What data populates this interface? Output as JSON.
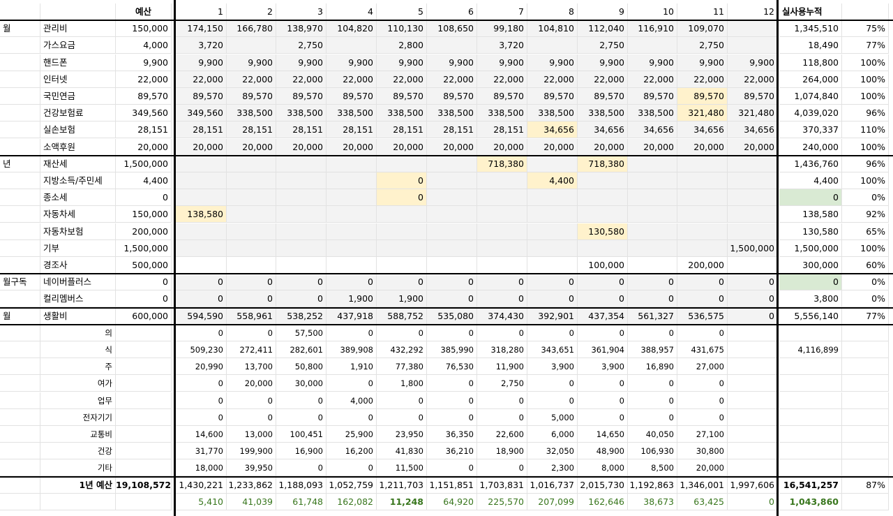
{
  "header": {
    "budget": "예산",
    "months": [
      "1",
      "2",
      "3",
      "4",
      "5",
      "6",
      "7",
      "8",
      "9",
      "10",
      "11",
      "12"
    ],
    "cumulative": "실사용누적"
  },
  "rows": [
    {
      "g": "월",
      "n": "관리비",
      "b": "150,000",
      "m": [
        "174,150",
        "166,780",
        "138,970",
        "104,820",
        "110,130",
        "108,650",
        "99,180",
        "104,810",
        "112,040",
        "116,910",
        "109,070",
        ""
      ],
      "c": "1,345,510",
      "p": "75%",
      "bg": "grey",
      "hi": {}
    },
    {
      "g": "",
      "n": "가스요금",
      "b": "4,000",
      "m": [
        "3,720",
        "",
        "2,750",
        "",
        "2,800",
        "",
        "3,720",
        "",
        "2,750",
        "",
        "2,750",
        ""
      ],
      "c": "18,490",
      "p": "77%",
      "bg": "grey",
      "hi": {}
    },
    {
      "g": "",
      "n": "핸드폰",
      "b": "9,900",
      "m": [
        "9,900",
        "9,900",
        "9,900",
        "9,900",
        "9,900",
        "9,900",
        "9,900",
        "9,900",
        "9,900",
        "9,900",
        "9,900",
        "9,900"
      ],
      "c": "118,800",
      "p": "100%",
      "bg": "grey",
      "hi": {}
    },
    {
      "g": "",
      "n": "인터넷",
      "b": "22,000",
      "m": [
        "22,000",
        "22,000",
        "22,000",
        "22,000",
        "22,000",
        "22,000",
        "22,000",
        "22,000",
        "22,000",
        "22,000",
        "22,000",
        "22,000"
      ],
      "c": "264,000",
      "p": "100%",
      "bg": "grey",
      "hi": {}
    },
    {
      "g": "",
      "n": "국민연금",
      "b": "89,570",
      "m": [
        "89,570",
        "89,570",
        "89,570",
        "89,570",
        "89,570",
        "89,570",
        "89,570",
        "89,570",
        "89,570",
        "89,570",
        "89,570",
        "89,570"
      ],
      "c": "1,074,840",
      "p": "100%",
      "bg": "grey",
      "hi": {
        "11": "yel"
      }
    },
    {
      "g": "",
      "n": "건강보험료",
      "b": "349,560",
      "m": [
        "349,560",
        "338,500",
        "338,500",
        "338,500",
        "338,500",
        "338,500",
        "338,500",
        "338,500",
        "338,500",
        "338,500",
        "321,480",
        "321,480"
      ],
      "c": "4,039,020",
      "p": "96%",
      "bg": "grey",
      "hi": {
        "11": "yel"
      }
    },
    {
      "g": "",
      "n": "실손보험",
      "b": "28,151",
      "m": [
        "28,151",
        "28,151",
        "28,151",
        "28,151",
        "28,151",
        "28,151",
        "28,151",
        "34,656",
        "34,656",
        "34,656",
        "34,656",
        "34,656"
      ],
      "c": "370,337",
      "p": "110%",
      "bg": "grey",
      "hi": {
        "8": "yel"
      }
    },
    {
      "g": "",
      "n": "소액후원",
      "b": "20,000",
      "m": [
        "20,000",
        "20,000",
        "20,000",
        "20,000",
        "20,000",
        "20,000",
        "20,000",
        "20,000",
        "20,000",
        "20,000",
        "20,000",
        "20,000"
      ],
      "c": "240,000",
      "p": "100%",
      "bg": "grey",
      "hi": {}
    },
    {
      "g": "년",
      "n": "재산세",
      "b": "1,500,000",
      "m": [
        "",
        "",
        "",
        "",
        "",
        "",
        "718,380",
        "",
        "718,380",
        "",
        "",
        ""
      ],
      "c": "1,436,760",
      "p": "96%",
      "bg": "grey",
      "hi": {
        "7": "yel",
        "9": "yel"
      }
    },
    {
      "g": "",
      "n": "지방소득/주민세",
      "b": "4,400",
      "m": [
        "",
        "",
        "",
        "",
        "0",
        "",
        "",
        "4,400",
        "",
        "",
        "",
        ""
      ],
      "c": "4,400",
      "p": "100%",
      "bg": "grey",
      "hi": {
        "5": "yel",
        "8": "yel"
      }
    },
    {
      "g": "",
      "n": "종소세",
      "b": "0",
      "m": [
        "",
        "",
        "",
        "",
        "0",
        "",
        "",
        "",
        "",
        "",
        "",
        ""
      ],
      "c": "0",
      "p": "0%",
      "bg": "grey",
      "hi": {
        "5": "yel",
        "c": "grn"
      }
    },
    {
      "g": "",
      "n": "자동차세",
      "b": "150,000",
      "m": [
        "138,580",
        "",
        "",
        "",
        "",
        "",
        "",
        "",
        "",
        "",
        "",
        ""
      ],
      "c": "138,580",
      "p": "92%",
      "bg": "grey",
      "hi": {
        "1": "yel"
      }
    },
    {
      "g": "",
      "n": "자동차보험",
      "b": "200,000",
      "m": [
        "",
        "",
        "",
        "",
        "",
        "",
        "",
        "",
        "130,580",
        "",
        "",
        ""
      ],
      "c": "130,580",
      "p": "65%",
      "bg": "grey",
      "hi": {
        "9": "yel"
      }
    },
    {
      "g": "",
      "n": "기부",
      "b": "1,500,000",
      "m": [
        "",
        "",
        "",
        "",
        "",
        "",
        "",
        "",
        "",
        "",
        "",
        "1,500,000"
      ],
      "c": "1,500,000",
      "p": "100%",
      "bg": "grey",
      "hi": {}
    },
    {
      "g": "",
      "n": "경조사",
      "b": "500,000",
      "m": [
        "",
        "",
        "",
        "",
        "",
        "",
        "",
        "",
        "100,000",
        "",
        "200,000",
        ""
      ],
      "c": "300,000",
      "p": "60%",
      "bg": "white",
      "hi": {}
    },
    {
      "g": "월구독",
      "n": "네이버플러스",
      "b": "0",
      "m": [
        "0",
        "0",
        "0",
        "0",
        "0",
        "0",
        "0",
        "0",
        "0",
        "0",
        "0",
        "0"
      ],
      "c": "0",
      "p": "0%",
      "bg": "grey",
      "hi": {
        "c": "grn"
      }
    },
    {
      "g": "",
      "n": "컬리멤버스",
      "b": "0",
      "m": [
        "0",
        "0",
        "0",
        "1,900",
        "1,900",
        "0",
        "0",
        "0",
        "0",
        "0",
        "0",
        "0"
      ],
      "c": "3,800",
      "p": "0%",
      "bg": "grey",
      "hi": {}
    },
    {
      "g": "월",
      "n": "생활비",
      "b": "600,000",
      "m": [
        "594,590",
        "558,961",
        "538,252",
        "437,918",
        "588,752",
        "535,080",
        "374,430",
        "392,901",
        "437,354",
        "561,327",
        "536,575",
        "0"
      ],
      "c": "5,556,140",
      "p": "77%",
      "bg": "grey",
      "hi": {}
    }
  ],
  "subrows": [
    {
      "n": "의",
      "m": [
        "0",
        "0",
        "57,500",
        "0",
        "0",
        "0",
        "0",
        "0",
        "0",
        "0",
        "0"
      ],
      "c": ""
    },
    {
      "n": "식",
      "m": [
        "509,230",
        "272,411",
        "282,601",
        "389,908",
        "432,292",
        "385,990",
        "318,280",
        "343,651",
        "361,904",
        "388,957",
        "431,675"
      ],
      "c": "4,116,899"
    },
    {
      "n": "주",
      "m": [
        "20,990",
        "13,700",
        "50,800",
        "1,910",
        "77,380",
        "76,530",
        "11,900",
        "3,900",
        "3,900",
        "16,890",
        "27,000"
      ],
      "c": ""
    },
    {
      "n": "여가",
      "m": [
        "0",
        "20,000",
        "30,000",
        "0",
        "1,800",
        "0",
        "2,750",
        "0",
        "0",
        "0",
        "0"
      ],
      "c": ""
    },
    {
      "n": "업무",
      "m": [
        "0",
        "0",
        "0",
        "4,000",
        "0",
        "0",
        "0",
        "0",
        "0",
        "0",
        "0"
      ],
      "c": ""
    },
    {
      "n": "전자기기",
      "m": [
        "0",
        "0",
        "0",
        "0",
        "0",
        "0",
        "0",
        "5,000",
        "0",
        "0",
        "0"
      ],
      "c": ""
    },
    {
      "n": "교통비",
      "m": [
        "14,600",
        "13,000",
        "100,451",
        "25,900",
        "23,950",
        "36,350",
        "22,600",
        "6,000",
        "14,650",
        "40,050",
        "27,100"
      ],
      "c": ""
    },
    {
      "n": "건강",
      "m": [
        "31,770",
        "199,900",
        "16,900",
        "16,200",
        "41,830",
        "36,210",
        "18,900",
        "32,050",
        "48,900",
        "106,930",
        "30,800"
      ],
      "c": ""
    },
    {
      "n": "기타",
      "m": [
        "18,000",
        "39,950",
        "0",
        "0",
        "11,500",
        "0",
        "0",
        "2,300",
        "8,000",
        "8,500",
        "20,000"
      ],
      "c": ""
    }
  ],
  "total": {
    "label": "1년 예산",
    "b": "19,108,572",
    "m": [
      "1,430,221",
      "1,233,862",
      "1,188,093",
      "1,052,759",
      "1,211,703",
      "1,151,851",
      "1,703,831",
      "1,016,737",
      "2,015,730",
      "1,192,863",
      "1,346,001",
      "1,997,606"
    ],
    "c": "16,541,257",
    "p": "87%"
  },
  "diff": {
    "m": [
      "5,410",
      "41,039",
      "61,748",
      "162,082",
      "11,248",
      "64,920",
      "225,570",
      "207,099",
      "162,646",
      "38,673",
      "63,425",
      "0"
    ],
    "c": "1,043,860"
  },
  "colors": {
    "grey": "#f3f3f3",
    "yellow": "#fff2cc",
    "green_fill": "#d9ead3",
    "green_text": "#38761d"
  }
}
